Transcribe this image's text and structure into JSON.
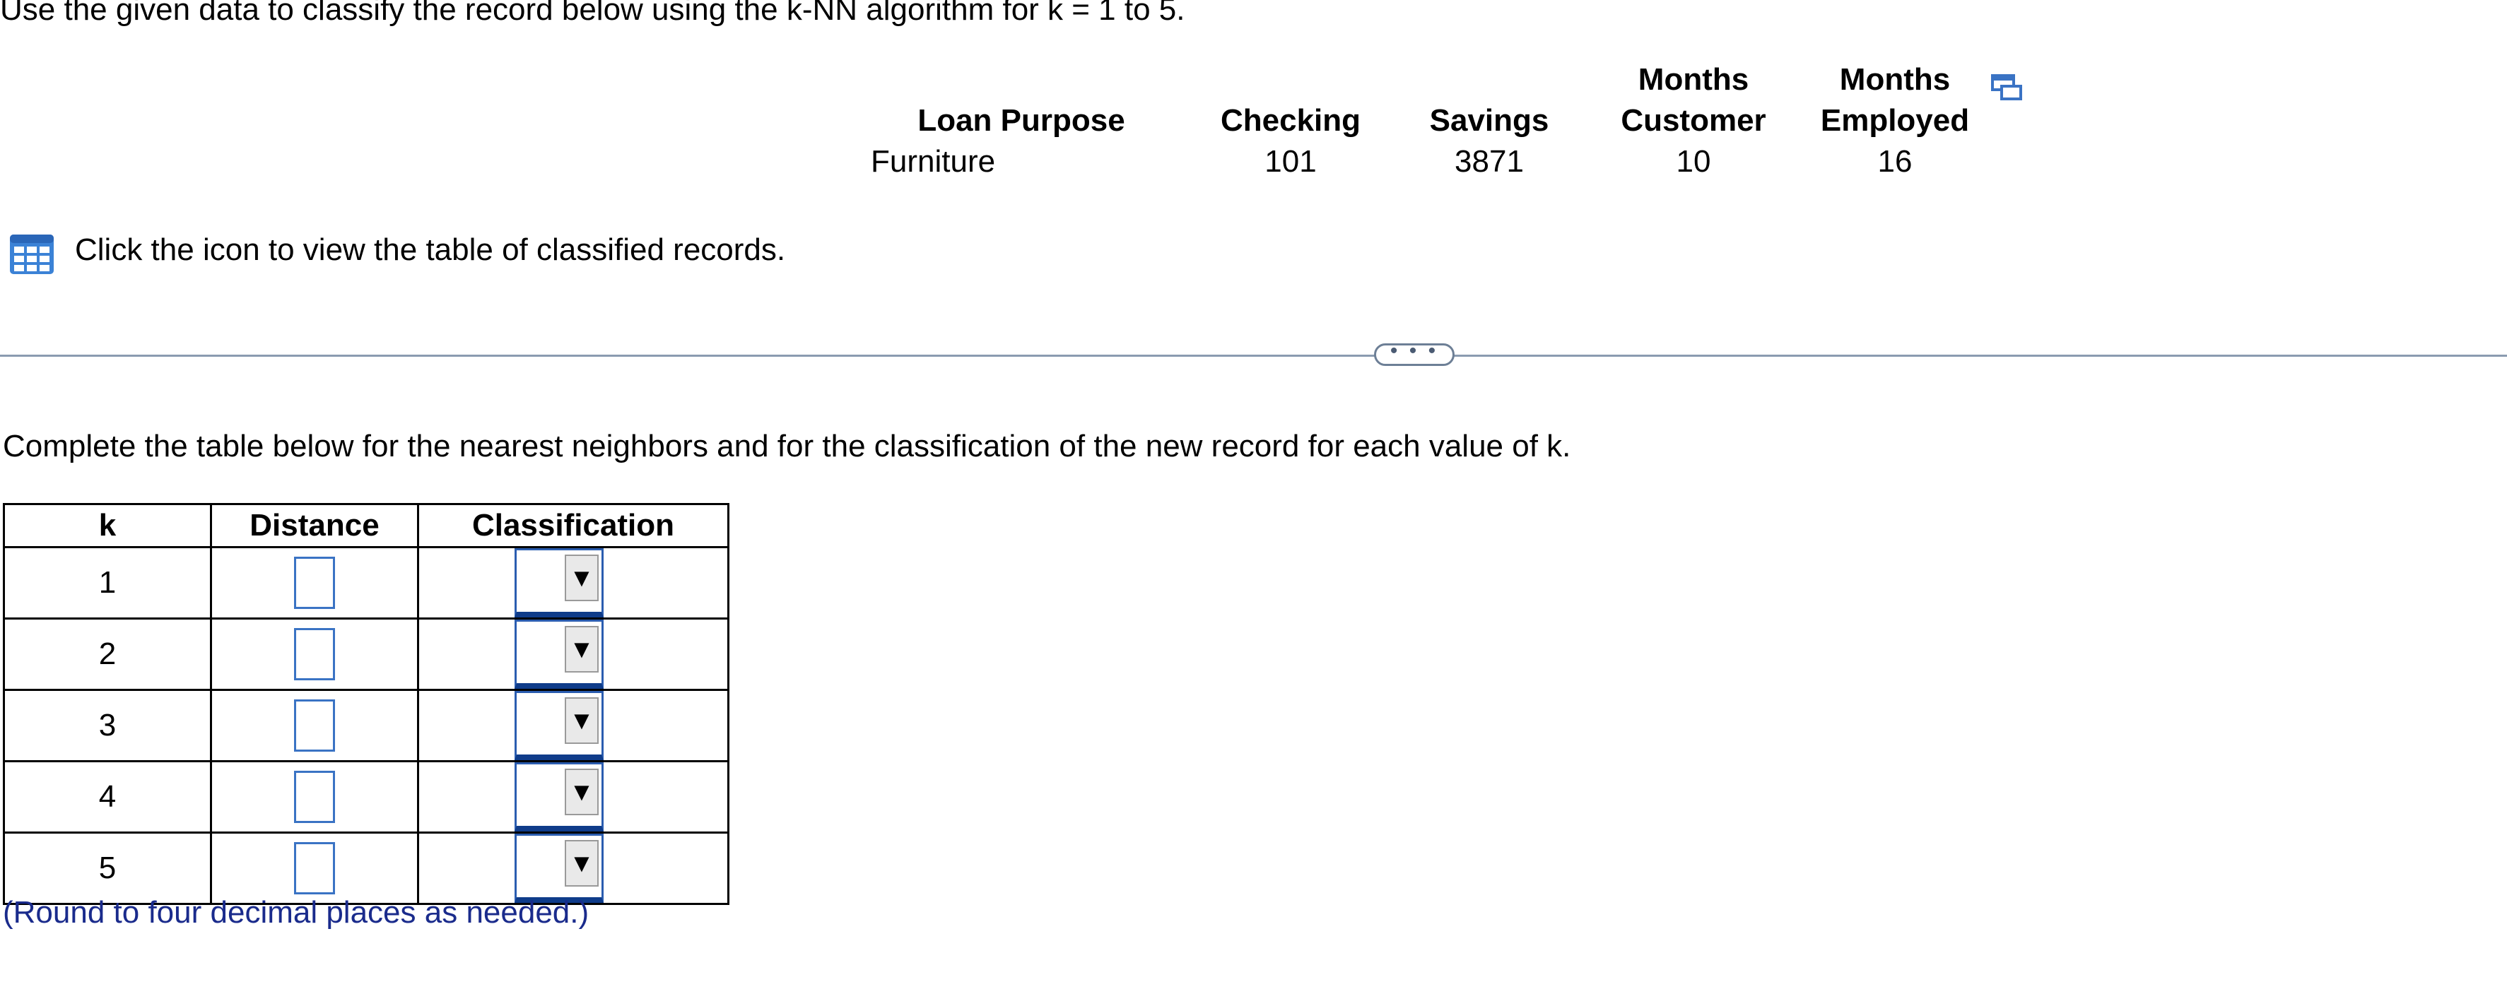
{
  "question": {
    "intro": "Use the given data to classify the record below using the k-NN algorithm for k = 1 to 5.",
    "record_table": {
      "headers": [
        {
          "line1": "",
          "line2": "Loan Purpose"
        },
        {
          "line1": "",
          "line2": "Checking"
        },
        {
          "line1": "",
          "line2": "Savings"
        },
        {
          "line1": "Months",
          "line2": "Customer"
        },
        {
          "line1": "Months",
          "line2": "Employed"
        }
      ],
      "row": [
        "Furniture",
        "101",
        "3871",
        "10",
        "16"
      ]
    },
    "copy_icon": "copy-icon",
    "classified_link": {
      "icon": "table-grid-icon",
      "text": "Click the icon to view the table of classified records."
    },
    "more_button": "• • •",
    "instruction": "Complete the table below for the nearest neighbors and for the classification of the new record for each value of k.",
    "answer_table": {
      "headers": [
        "k",
        "Distance",
        "Classification"
      ],
      "rows": [
        {
          "k": "1",
          "distance": "",
          "classification": ""
        },
        {
          "k": "2",
          "distance": "",
          "classification": ""
        },
        {
          "k": "3",
          "distance": "",
          "classification": ""
        },
        {
          "k": "4",
          "distance": "",
          "classification": ""
        },
        {
          "k": "5",
          "distance": "",
          "classification": ""
        }
      ],
      "dropdown_arrow": "▼"
    },
    "note": "(Round to four decimal places as needed.)"
  },
  "colors": {
    "accent": "#3a73c4",
    "note_text": "#1a2b8c",
    "divider": "#8a9bb0"
  }
}
